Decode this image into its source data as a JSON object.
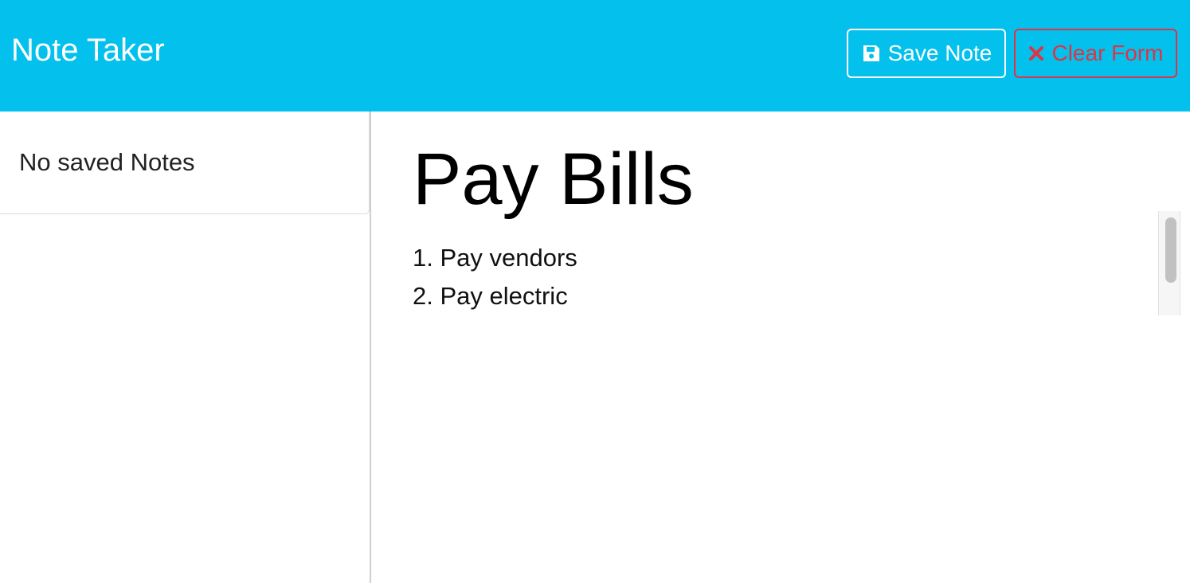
{
  "app": {
    "title": "Note Taker"
  },
  "toolbar": {
    "save_label": "Save Note",
    "save_icon": "floppy-disk-icon",
    "clear_label": "Clear Form",
    "clear_icon": "x-mark-icon"
  },
  "sidebar": {
    "empty_message": "No saved Notes"
  },
  "note": {
    "title": "Pay Bills",
    "lines": [
      "1. Pay vendors",
      "2. Pay electric"
    ]
  },
  "colors": {
    "header_bg": "#03c1ec",
    "clear_button": "#dc3545",
    "save_button": "#ffffff"
  }
}
